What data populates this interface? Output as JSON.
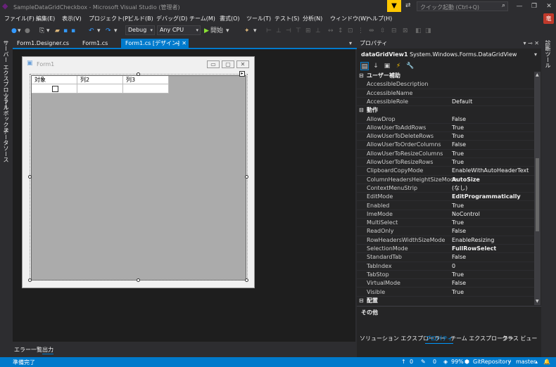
{
  "window": {
    "title": "SampleDataGridCheckbox - Microsoft Visual Studio (管理者)",
    "quick_launch_placeholder": "クイック起動 (Ctrl+Q)",
    "user_badge": "竜"
  },
  "menu": [
    "ファイル(F)",
    "編集(E)",
    "表示(V)",
    "プロジェクト(P)",
    "ビルド(B)",
    "デバッグ(D)",
    "チーム(M)",
    "書式(O)",
    "ツール(T)",
    "テスト(S)",
    "分析(N)",
    "ウィンドウ(W)",
    "ヘルプ(H)"
  ],
  "toolbar": {
    "config": "Debug",
    "platform": "Any CPU",
    "start": "開始"
  },
  "left_rail": [
    "サーバー エクスプローラー",
    "ツールボックス",
    "データソース"
  ],
  "tabs": [
    "Form1.Designer.cs",
    "Form1.cs",
    "Form1.cs [デザイン]"
  ],
  "form": {
    "title": "Form1",
    "columns": [
      "対象",
      "列2",
      "列3"
    ]
  },
  "bottom_tabs": [
    "エラー一覧",
    "出力"
  ],
  "properties": {
    "header": "プロパティ",
    "object_name": "dataGridView1",
    "object_type": "System.Windows.Forms.DataGridView",
    "categories": [
      {
        "label": "ユーザー補助",
        "rows": [
          {
            "name": "AccessibleDescription",
            "value": "",
            "bold": false
          },
          {
            "name": "AccessibleName",
            "value": "",
            "bold": false
          },
          {
            "name": "AccessibleRole",
            "value": "Default",
            "bold": false
          }
        ]
      },
      {
        "label": "動作",
        "rows": [
          {
            "name": "AllowDrop",
            "value": "False",
            "bold": false
          },
          {
            "name": "AllowUserToAddRows",
            "value": "True",
            "bold": false
          },
          {
            "name": "AllowUserToDeleteRows",
            "value": "True",
            "bold": false
          },
          {
            "name": "AllowUserToOrderColumns",
            "value": "False",
            "bold": false
          },
          {
            "name": "AllowUserToResizeColumns",
            "value": "True",
            "bold": false
          },
          {
            "name": "AllowUserToResizeRows",
            "value": "True",
            "bold": false
          },
          {
            "name": "ClipboardCopyMode",
            "value": "EnableWithAutoHeaderText",
            "bold": false
          },
          {
            "name": "ColumnHeadersHeightSizeMode",
            "value": "AutoSize",
            "bold": true
          },
          {
            "name": "ContextMenuStrip",
            "value": "(なし)",
            "bold": false
          },
          {
            "name": "EditMode",
            "value": "EditProgrammatically",
            "bold": true
          },
          {
            "name": "Enabled",
            "value": "True",
            "bold": false
          },
          {
            "name": "ImeMode",
            "value": "NoControl",
            "bold": false
          },
          {
            "name": "MultiSelect",
            "value": "True",
            "bold": false
          },
          {
            "name": "ReadOnly",
            "value": "False",
            "bold": false
          },
          {
            "name": "RowHeadersWidthSizeMode",
            "value": "EnableResizing",
            "bold": false
          },
          {
            "name": "SelectionMode",
            "value": "FullRowSelect",
            "bold": true
          },
          {
            "name": "StandardTab",
            "value": "False",
            "bold": false
          },
          {
            "name": "TabIndex",
            "value": "0",
            "bold": false
          },
          {
            "name": "TabStop",
            "value": "True",
            "bold": false
          },
          {
            "name": "VirtualMode",
            "value": "False",
            "bold": false
          },
          {
            "name": "Visible",
            "value": "True",
            "bold": false
          }
        ]
      },
      {
        "label": "配置",
        "rows": []
      }
    ],
    "description_title": "その他",
    "bottom_tabs": [
      "ソリューション エクスプローラー",
      "プロパティ",
      "チーム エクスプローラー",
      "クラス ビュー"
    ]
  },
  "right_rail": "診断ツール",
  "status": {
    "left": "準備完了",
    "up_count": "0",
    "pencil_count": "0",
    "zoom": "99%",
    "repo": "GitRepository",
    "branch": "master"
  }
}
